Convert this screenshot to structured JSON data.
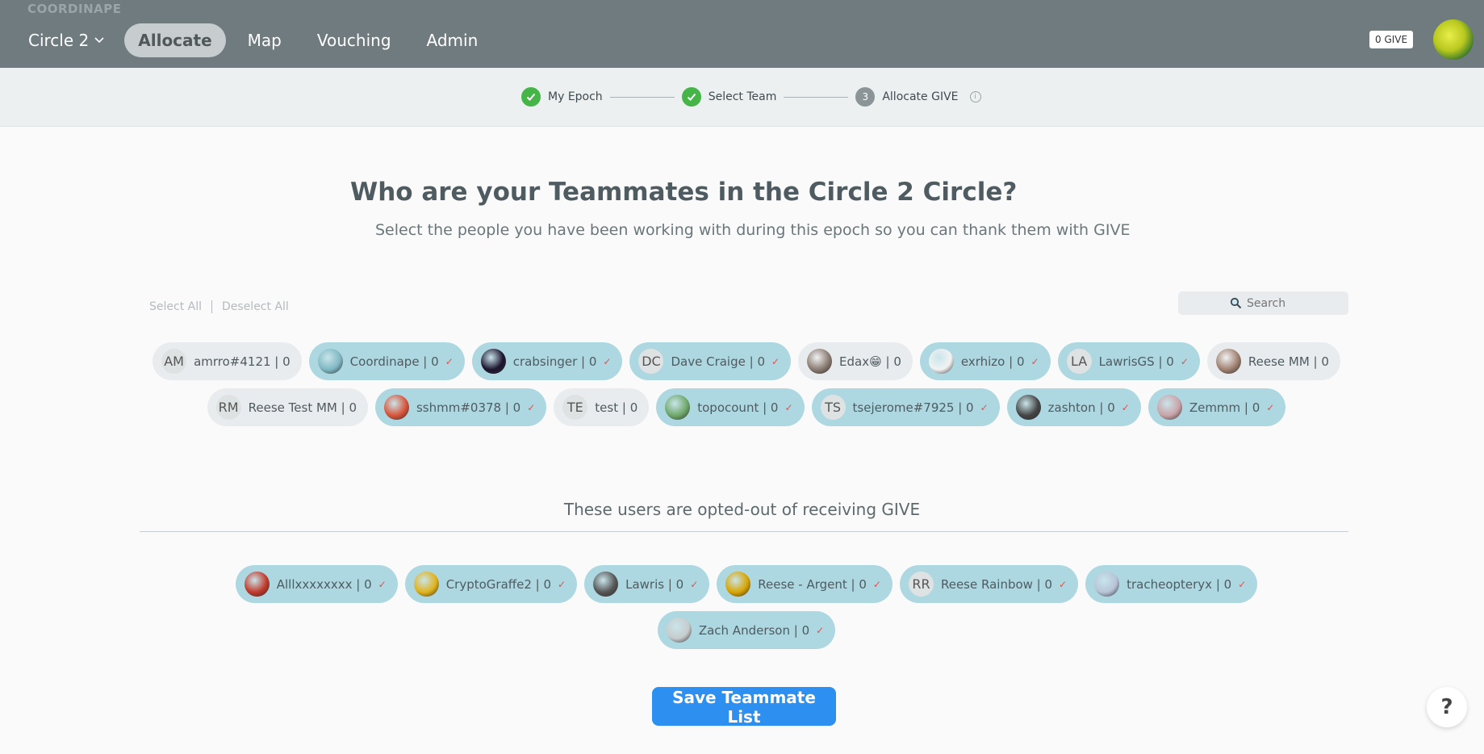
{
  "brand": "COORDINAPE",
  "nav": {
    "circle": "Circle 2",
    "items": [
      "Allocate",
      "Map",
      "Vouching",
      "Admin"
    ]
  },
  "give_badge": "0 GIVE",
  "steps": [
    {
      "label": "My Epoch",
      "done": true
    },
    {
      "label": "Select Team",
      "done": true
    },
    {
      "label": "Allocate GIVE",
      "number": "3",
      "done": false
    }
  ],
  "title": "Who are your Teammates in the Circle 2 Circle?",
  "subtitle": "Select the people you have been working with during this epoch so you can thank them with GIVE",
  "select_all": "Select All",
  "deselect_all": "Deselect All",
  "search": {
    "placeholder": "Search",
    "value": ""
  },
  "check_mark": "✓",
  "teammates": [
    {
      "label": "amrro#4121 | 0",
      "initials": "AM",
      "selected": false,
      "avatar": "initials"
    },
    {
      "label": "Coordinape | 0",
      "selected": true,
      "avatar": "coordinape-logo",
      "color": "#7fb8c3"
    },
    {
      "label": "crabsinger | 0",
      "selected": true,
      "avatar": "dark-pattern",
      "color": "#1d1530"
    },
    {
      "label": "Dave Craige | 0",
      "initials": "DC",
      "selected": true,
      "avatar": "initials"
    },
    {
      "label": "Edax😁 | 0",
      "selected": false,
      "avatar": "photo",
      "color": "#8a7b70"
    },
    {
      "label": "exrhizo | 0",
      "selected": true,
      "avatar": "sketch",
      "color": "#f2f2f2"
    },
    {
      "label": "LawrisGS | 0",
      "initials": "LA",
      "selected": true,
      "avatar": "initials"
    },
    {
      "label": "Reese MM | 0",
      "selected": false,
      "avatar": "photo",
      "color": "#a08070"
    },
    {
      "label": "Reese Test MM | 0",
      "initials": "RM",
      "selected": false,
      "avatar": "initials"
    },
    {
      "label": "sshmm#0378 | 0",
      "selected": true,
      "avatar": "coral",
      "color": "#d8553a"
    },
    {
      "label": "test | 0",
      "initials": "TE",
      "selected": false,
      "avatar": "initials"
    },
    {
      "label": "topocount | 0",
      "selected": true,
      "avatar": "punk",
      "color": "#6fa86a"
    },
    {
      "label": "tsejerome#7925 | 0",
      "initials": "TS",
      "selected": true,
      "avatar": "initials"
    },
    {
      "label": "zashton | 0",
      "selected": true,
      "avatar": "sketch-bw",
      "color": "#444444"
    },
    {
      "label": "Zemmm | 0",
      "selected": true,
      "avatar": "photo",
      "color": "#c9a3a8"
    }
  ],
  "opted_out_heading": "These users are opted-out of receiving GIVE",
  "opted_out": [
    {
      "label": "Alllxxxxxxxx | 0",
      "selected": true,
      "avatar": "box",
      "color": "#c0392b"
    },
    {
      "label": "CryptoGraffe2 | 0",
      "selected": true,
      "avatar": "giraffe",
      "color": "#e0b21a"
    },
    {
      "label": "Lawris | 0",
      "selected": true,
      "avatar": "sketch-bw",
      "color": "#555555"
    },
    {
      "label": "Reese - Argent | 0",
      "selected": true,
      "avatar": "portrait",
      "color": "#d8a400"
    },
    {
      "label": "Reese Rainbow | 0",
      "initials": "RR",
      "selected": true,
      "avatar": "initials"
    },
    {
      "label": "tracheopteryx | 0",
      "selected": true,
      "avatar": "photo",
      "color": "#b7c4d8"
    },
    {
      "label": "Zach Anderson | 0",
      "selected": true,
      "avatar": "photo",
      "color": "#c7cccc"
    }
  ],
  "save_button": "Save Teammate List",
  "help": "?"
}
